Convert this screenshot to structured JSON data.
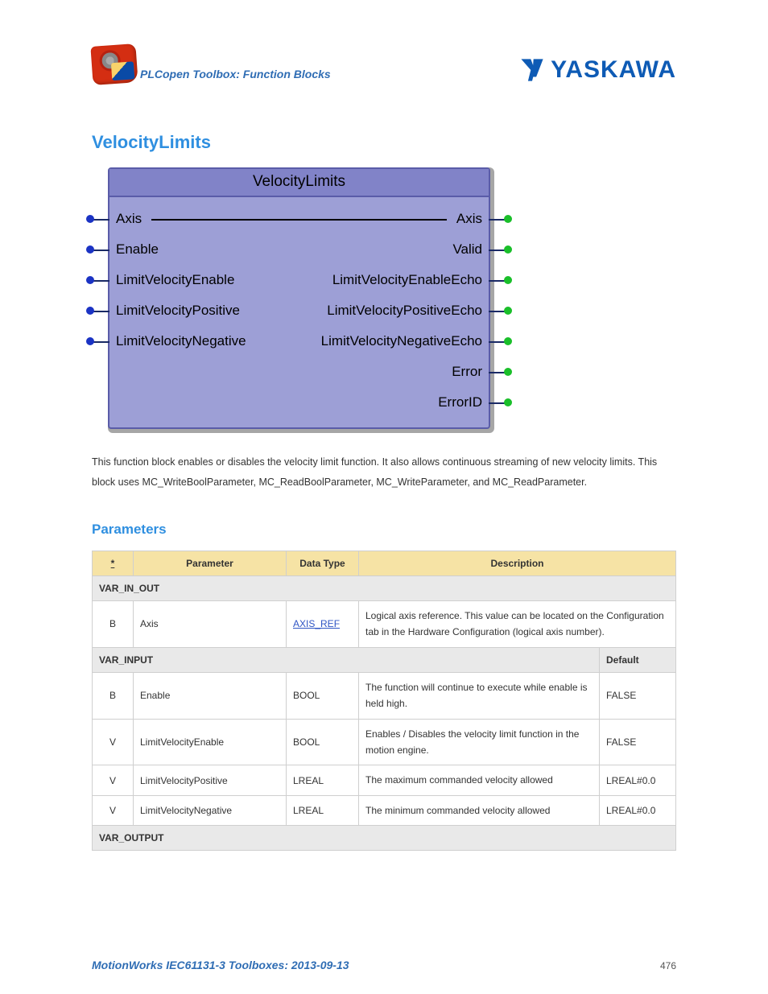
{
  "header": {
    "breadcrumb": "PLCopen Toolbox: Function Blocks",
    "brand": "YASKAWA"
  },
  "title": "VelocityLimits",
  "fb": {
    "title": "VelocityLimits",
    "rows": [
      {
        "left": "Axis",
        "right": "Axis",
        "hasLeftPin": true,
        "hasRightPin": true,
        "axisLine": true
      },
      {
        "left": "Enable",
        "right": "Valid",
        "hasLeftPin": true,
        "hasRightPin": true,
        "axisLine": false
      },
      {
        "left": "LimitVelocityEnable",
        "right": "LimitVelocityEnableEcho",
        "hasLeftPin": true,
        "hasRightPin": true,
        "axisLine": false
      },
      {
        "left": "LimitVelocityPositive",
        "right": "LimitVelocityPositiveEcho",
        "hasLeftPin": true,
        "hasRightPin": true,
        "axisLine": false
      },
      {
        "left": "LimitVelocityNegative",
        "right": "LimitVelocityNegativeEcho",
        "hasLeftPin": true,
        "hasRightPin": true,
        "axisLine": false
      },
      {
        "left": "",
        "right": "Error",
        "hasLeftPin": false,
        "hasRightPin": true,
        "axisLine": false
      },
      {
        "left": "",
        "right": "ErrorID",
        "hasLeftPin": false,
        "hasRightPin": true,
        "axisLine": false
      }
    ]
  },
  "description": "This function block enables or disables the velocity limit function.  It also allows continuous streaming of new velocity limits.  This block uses MC_WriteBoolParameter, MC_ReadBoolParameter, MC_WriteParameter, and MC_ReadParameter.",
  "parametersHeading": "Parameters",
  "table": {
    "headers": {
      "star": "*",
      "param": "Parameter",
      "type": "Data Type",
      "desc": "Description",
      "default": "Default"
    },
    "sections": {
      "inout": "VAR_IN_OUT",
      "input": "VAR_INPUT",
      "output": "VAR_OUTPUT"
    },
    "inout_rows": [
      {
        "star": "B",
        "param": "Axis",
        "type": "AXIS_REF",
        "typeIsLink": true,
        "desc": "Logical axis reference. This value can be located on the Configuration tab in the Hardware Configuration (logical axis number)."
      }
    ],
    "input_rows": [
      {
        "star": "B",
        "param": "Enable",
        "type": "BOOL",
        "desc": "The function will continue to execute while enable is held high.",
        "default": "FALSE"
      },
      {
        "star": "V",
        "param": "LimitVelocityEnable",
        "type": "BOOL",
        "desc": "Enables / Disables the velocity limit function in the motion engine.",
        "default": "FALSE"
      },
      {
        "star": "V",
        "param": "LimitVelocityPositive",
        "type": "LREAL",
        "desc": "The maximum commanded velocity allowed",
        "default": "LREAL#0.0"
      },
      {
        "star": "V",
        "param": "LimitVelocityNegative",
        "type": "LREAL",
        "desc": "The minimum commanded velocity allowed",
        "default": "LREAL#0.0"
      }
    ]
  },
  "footer": {
    "title": "MotionWorks IEC61131-3 Toolboxes: 2013-09-13",
    "page": "476"
  }
}
